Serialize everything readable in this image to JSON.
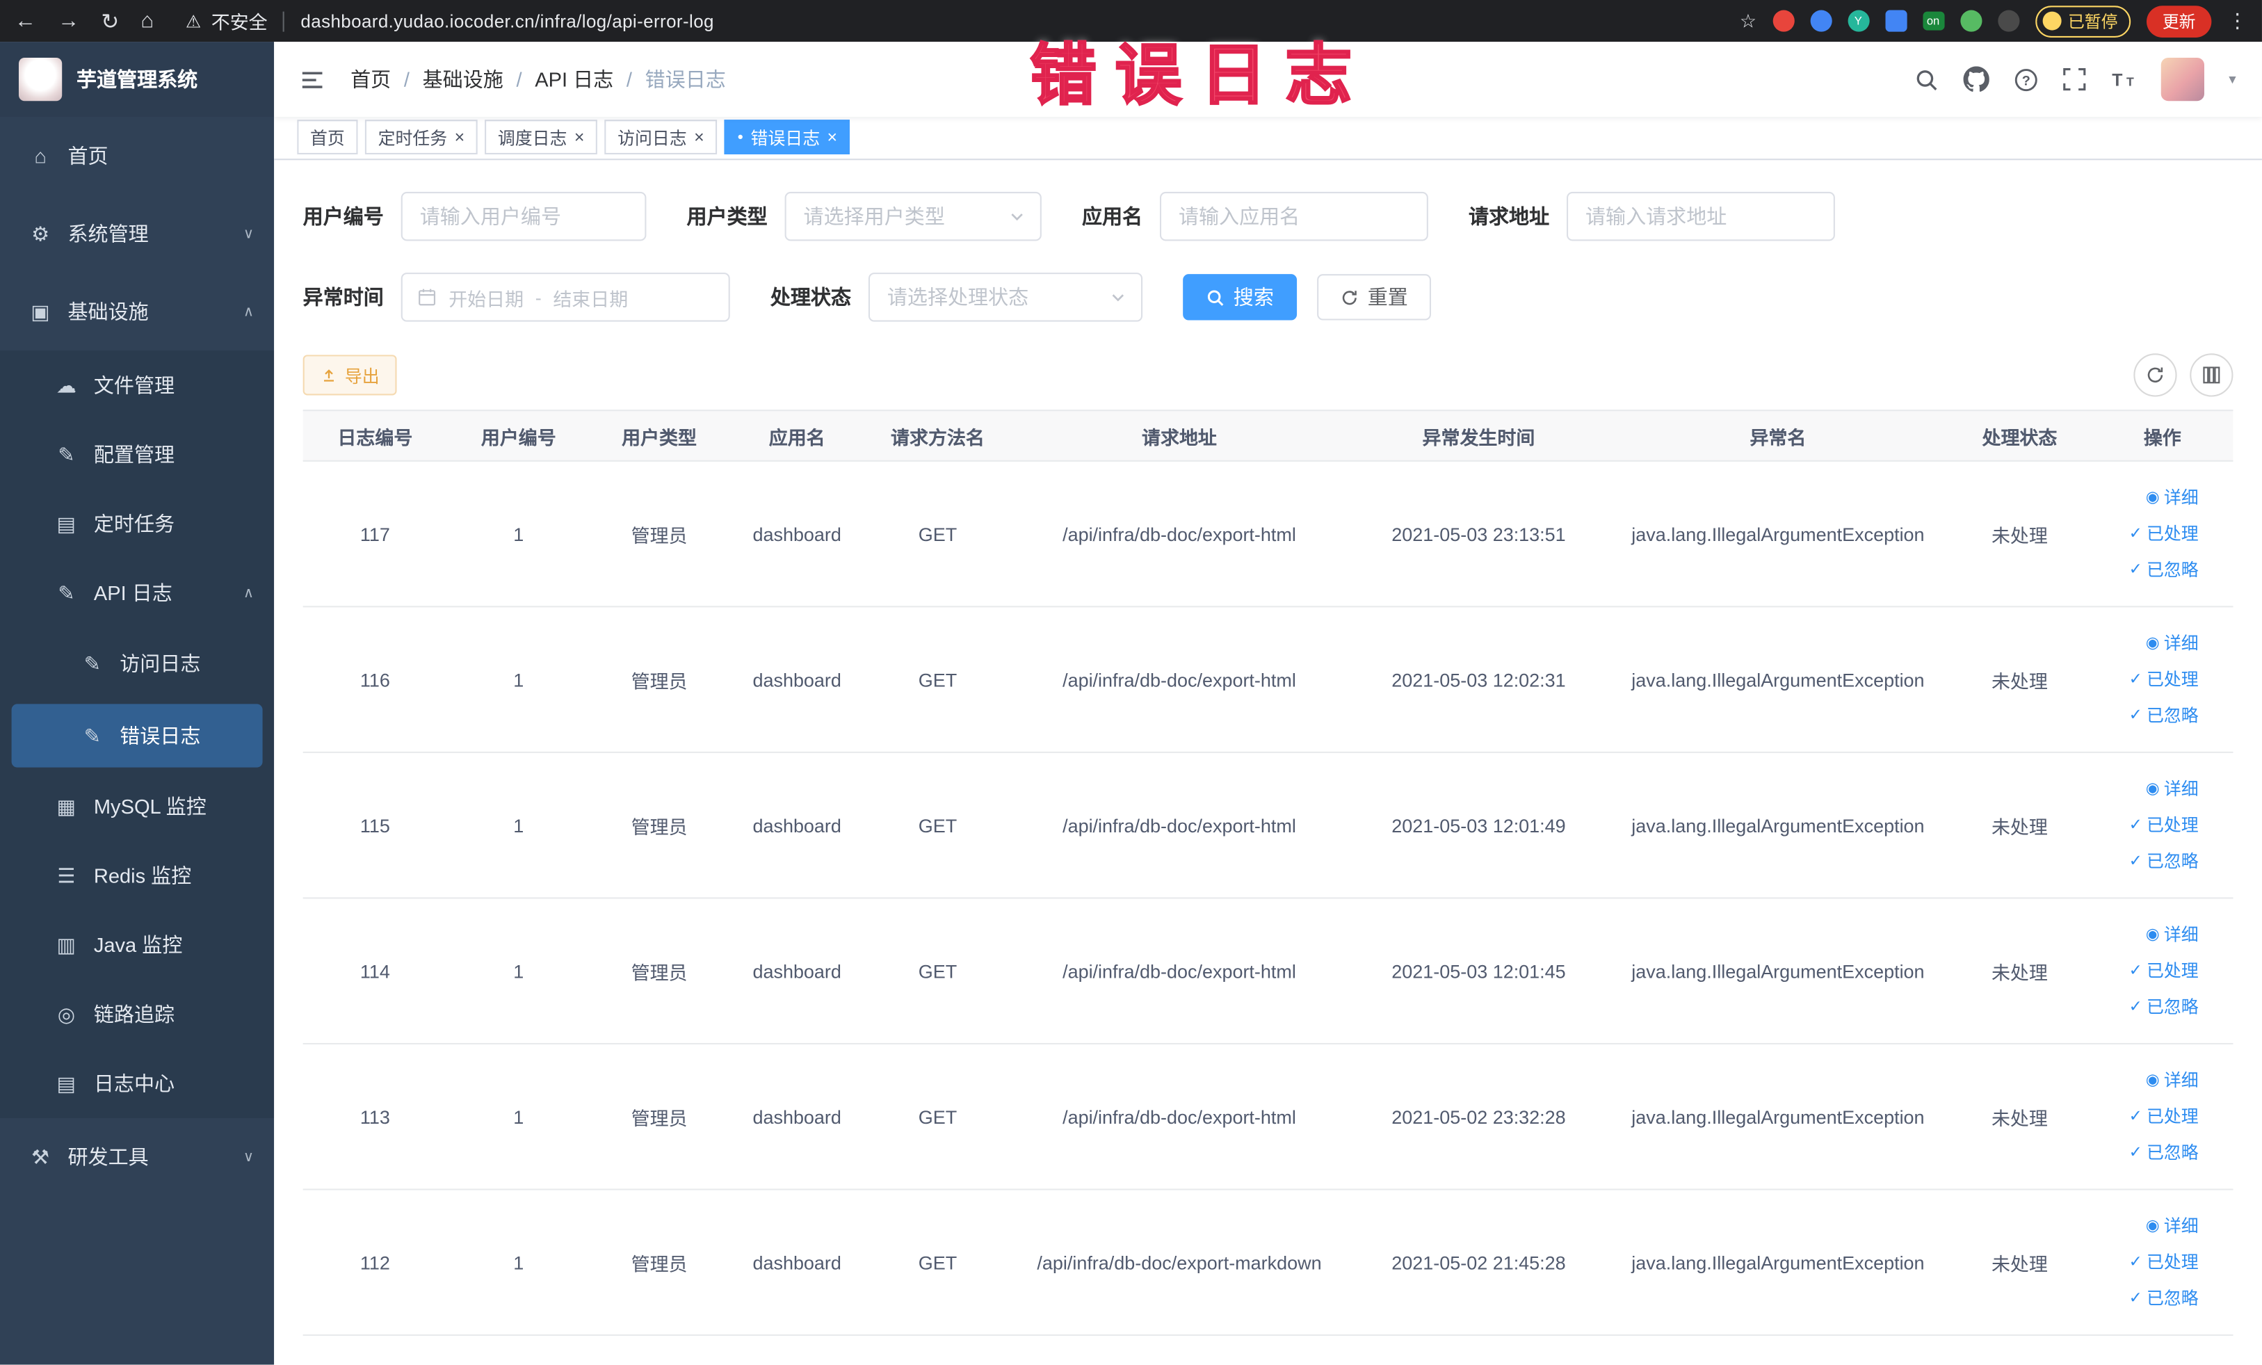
{
  "annotation": {
    "text": "错误日志"
  },
  "browser": {
    "security_label": "不安全",
    "url": "dashboard.yudao.iocoder.cn/infra/log/api-error-log",
    "paused_badge": "已暂停",
    "update_button": "更新",
    "extension_on_badge": "on"
  },
  "icons": {
    "back": "←",
    "forward": "→",
    "reload": "↻",
    "home": "⌂",
    "warning": "⚠",
    "star": "☆",
    "more": "⋮",
    "close": "×",
    "dot": "●",
    "chevron_down": "∨",
    "chevron_up": "∧",
    "caret_down": "▾",
    "menu_home": "⌂",
    "menu_system": "⚙",
    "menu_infra": "▣",
    "menu_file": "☁",
    "menu_config": "✎",
    "menu_task": "▤",
    "menu_apilog": "✎",
    "menu_doc": "✎",
    "menu_mysql": "▦",
    "menu_redis": "☰",
    "menu_java": "▥",
    "menu_trace": "◎",
    "menu_logcenter": "▤",
    "menu_devtools": "⚒",
    "detail": "◉",
    "check": "✓"
  },
  "sidebar": {
    "logo_title": "芋道管理系统",
    "home": "首页",
    "system_mgmt": "系统管理",
    "infrastructure": "基础设施",
    "file_mgmt": "文件管理",
    "config_mgmt": "配置管理",
    "scheduled_tasks": "定时任务",
    "api_log": "API 日志",
    "access_log": "访问日志",
    "error_log": "错误日志",
    "mysql_monitor": "MySQL 监控",
    "redis_monitor": "Redis 监控",
    "java_monitor": "Java 监控",
    "trace": "链路追踪",
    "log_center": "日志中心",
    "dev_tools": "研发工具"
  },
  "header": {
    "breadcrumb": [
      "首页",
      "基础设施",
      "API 日志",
      "错误日志"
    ],
    "separator": "/"
  },
  "tabs": [
    {
      "label": "首页"
    },
    {
      "label": "定时任务"
    },
    {
      "label": "调度日志"
    },
    {
      "label": "访问日志"
    },
    {
      "label": "错误日志"
    }
  ],
  "filters": {
    "user_id": {
      "label": "用户编号",
      "placeholder": "请输入用户编号"
    },
    "user_type": {
      "label": "用户类型",
      "placeholder": "请选择用户类型"
    },
    "app_name": {
      "label": "应用名",
      "placeholder": "请输入应用名"
    },
    "request_url": {
      "label": "请求地址",
      "placeholder": "请输入请求地址"
    },
    "exception_time": {
      "label": "异常时间",
      "start_placeholder": "开始日期",
      "separator": "-",
      "end_placeholder": "结束日期"
    },
    "process_status": {
      "label": "处理状态",
      "placeholder": "请选择处理状态"
    },
    "search_button": "搜索",
    "reset_button": "重置"
  },
  "toolbar": {
    "export_button": "导出"
  },
  "table": {
    "columns": [
      "日志编号",
      "用户编号",
      "用户类型",
      "应用名",
      "请求方法名",
      "请求地址",
      "异常发生时间",
      "异常名",
      "处理状态",
      "操作"
    ],
    "actions": {
      "detail": "详细",
      "processed": "已处理",
      "ignored": "已忽略"
    },
    "rows": [
      {
        "log_id": "117",
        "user_id": "1",
        "user_type": "管理员",
        "app": "dashboard",
        "method": "GET",
        "url": "/api/infra/db-doc/export-html",
        "time": "2021-05-03 23:13:51",
        "exception": "java.lang.IllegalArgumentException",
        "status": "未处理"
      },
      {
        "log_id": "116",
        "user_id": "1",
        "user_type": "管理员",
        "app": "dashboard",
        "method": "GET",
        "url": "/api/infra/db-doc/export-html",
        "time": "2021-05-03 12:02:31",
        "exception": "java.lang.IllegalArgumentException",
        "status": "未处理"
      },
      {
        "log_id": "115",
        "user_id": "1",
        "user_type": "管理员",
        "app": "dashboard",
        "method": "GET",
        "url": "/api/infra/db-doc/export-html",
        "time": "2021-05-03 12:01:49",
        "exception": "java.lang.IllegalArgumentException",
        "status": "未处理"
      },
      {
        "log_id": "114",
        "user_id": "1",
        "user_type": "管理员",
        "app": "dashboard",
        "method": "GET",
        "url": "/api/infra/db-doc/export-html",
        "time": "2021-05-03 12:01:45",
        "exception": "java.lang.IllegalArgumentException",
        "status": "未处理"
      },
      {
        "log_id": "113",
        "user_id": "1",
        "user_type": "管理员",
        "app": "dashboard",
        "method": "GET",
        "url": "/api/infra/db-doc/export-html",
        "time": "2021-05-02 23:32:28",
        "exception": "java.lang.IllegalArgumentException",
        "status": "未处理"
      },
      {
        "log_id": "112",
        "user_id": "1",
        "user_type": "管理员",
        "app": "dashboard",
        "method": "GET",
        "url": "/api/infra/db-doc/export-markdown",
        "time": "2021-05-02 21:45:28",
        "exception": "java.lang.IllegalArgumentException",
        "status": "未处理"
      }
    ]
  }
}
